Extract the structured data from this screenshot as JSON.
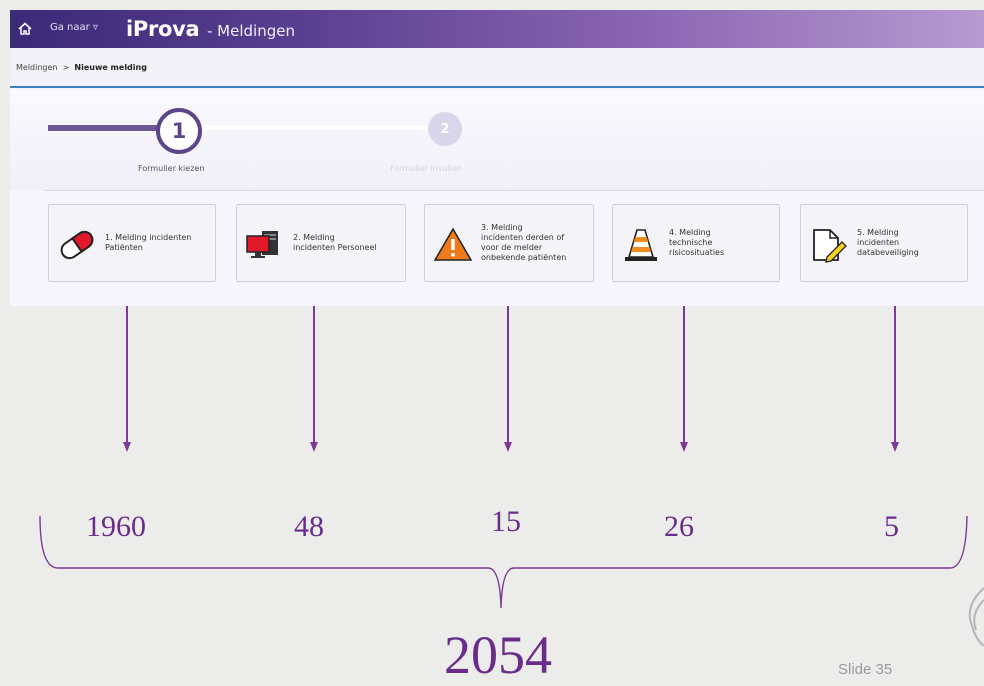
{
  "app": {
    "goto_label": "Ga naar",
    "brand": "iProva",
    "app_name": "- Meldingen"
  },
  "breadcrumb": {
    "root": "Meldingen",
    "separator": ">",
    "current": "Nieuwe melding"
  },
  "steps": [
    {
      "number": "1",
      "label": "Formulier kiezen",
      "active": true
    },
    {
      "number": "2",
      "label": "Formulier invullen",
      "active": false
    }
  ],
  "forms": [
    {
      "label": "1. Melding incidenten\nPatiënten",
      "icon": "pill-icon",
      "count": "1960"
    },
    {
      "label": "2. Melding\nincidenten Personeel",
      "icon": "computer-screen-icon",
      "count": "48"
    },
    {
      "label": "3. Melding\nincidenten derden of\nvoor de melder\nonbekende patiënten",
      "icon": "warning-icon",
      "count": "15"
    },
    {
      "label": "4. Melding\ntechnische\nrisicosituaties",
      "icon": "traffic-cone-icon",
      "count": "26"
    },
    {
      "label": "5. Melding\nincidenten\ndatabeveiliging",
      "icon": "document-edit-icon",
      "count": "5"
    }
  ],
  "total": "2054",
  "slide_label": "Slide 35",
  "colors": {
    "accent": "#6a2c8a",
    "topbar_start": "#3a2a78",
    "topbar_end": "#b69ad0",
    "step_active": "#5c4688"
  }
}
